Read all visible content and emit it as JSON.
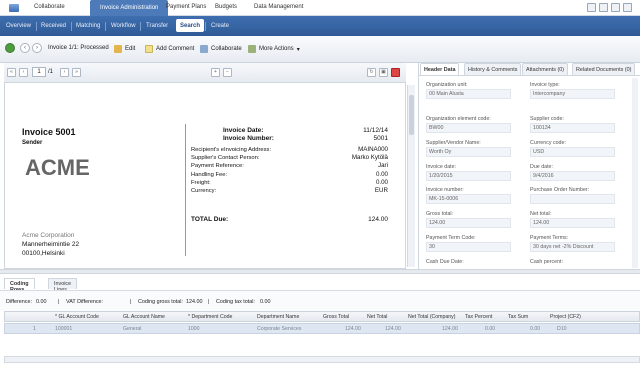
{
  "topnav": {
    "items": [
      "Collaborate",
      "Invoice Administration",
      "Payment Plans",
      "Budgets",
      "Data Management"
    ],
    "active": 1
  },
  "subnav": {
    "items": [
      "Overview",
      "Received",
      "Matching",
      "Workflow",
      "Transfer",
      "Search",
      "Create"
    ],
    "active": 5
  },
  "toolbar": {
    "invoice_status": "Invoice 1/1: Processed",
    "edit": "Edit",
    "add_comment": "Add Comment",
    "collaborate": "Collaborate",
    "more_actions": "More Actions"
  },
  "viewer": {
    "page": "1",
    "page_of": "/1"
  },
  "invoice": {
    "title": "Invoice 5001",
    "sender_label": "Sender",
    "logo": "ACME",
    "sender_name": "Acme Corporation",
    "sender_street": "Mannerheimintie 22",
    "sender_city": "00100,Helsinki",
    "date_label": "Invoice Date:",
    "date_value": "11/12/14",
    "number_label": "Invoice Number:",
    "number_value": "5001",
    "rows": [
      {
        "label": "Recipient's eInvoicing Address:",
        "value": "MAINA000"
      },
      {
        "label": "Supplier's Contact Person:",
        "value": "Marko Kytölä"
      },
      {
        "label": "Payment Reference:",
        "value": "Jari"
      },
      {
        "label": "Handling Fee:",
        "value": "0.00"
      },
      {
        "label": "Freight:",
        "value": "0.00"
      },
      {
        "label": "Currency:",
        "value": "EUR"
      }
    ],
    "total_label": "TOTAL Due:",
    "total_value": "124.00"
  },
  "right_tabs": [
    "Header Data",
    "History & Comments",
    "Attachments (0)",
    "Related Documents (0)"
  ],
  "header_fields": [
    {
      "label": "Organization unit:",
      "value": "00 Main Alusta"
    },
    {
      "label": "Invoice type:",
      "value": "Intercompany"
    },
    {
      "label": "Organization element code:",
      "value": "BW00"
    },
    {
      "label": "Supplier code:",
      "value": "100134"
    },
    {
      "label": "Supplier/Vendor Name:",
      "value": "Worth Oy"
    },
    {
      "label": "Currency code:",
      "value": "USD"
    },
    {
      "label": "Invoice date:",
      "value": "1/20/2015"
    },
    {
      "label": "Due date:",
      "value": "9/4/2016"
    },
    {
      "label": "Invoice number:",
      "value": "MK-15-0006"
    },
    {
      "label": "Purchase Order Number:",
      "value": ""
    },
    {
      "label": "Gross total:",
      "value": "124.00"
    },
    {
      "label": "Net total:",
      "value": "124.00"
    },
    {
      "label": "Payment Term Code:",
      "value": "30"
    },
    {
      "label": "Payment Terms:",
      "value": "30 days net -2% Discount"
    },
    {
      "label": "Cash Due Date:",
      "value": ""
    },
    {
      "label": "Cash percent:",
      "value": ""
    }
  ],
  "bottom_tabs": [
    "Coding Rows",
    "Invoice Lines"
  ],
  "summary": {
    "difference_label": "Difference:",
    "difference": "0.00",
    "vat_label": "VAT Difference:",
    "coding_gross_label": "Coding gross total:",
    "coding_gross": "124.00",
    "coding_tax_label": "Coding tax total:",
    "coding_tax": "0.00"
  },
  "grid": {
    "headers": [
      "* GL Account Code",
      "GL Account Name",
      "* Department Code",
      "Department Name",
      "Gross Total",
      "Net Total",
      "Net Total (Company)",
      "Tax Percent",
      "Tax Sum",
      "Project (CF2)"
    ],
    "rows": [
      [
        "1",
        "100001",
        "General",
        "1000",
        "Corporate Services",
        "124.00",
        "124.00",
        "124.00",
        "0.00",
        "0.00",
        "D10"
      ]
    ]
  },
  "colors": {
    "accent": "#2f5a96",
    "active_tab": "#4d7ab8"
  }
}
